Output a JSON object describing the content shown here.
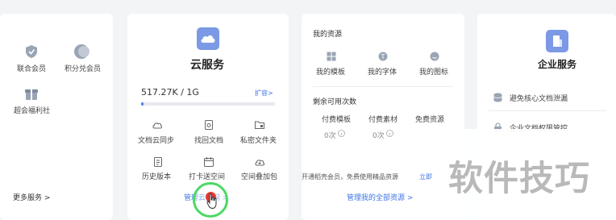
{
  "member_card": {
    "items": [
      {
        "label": "联合会员",
        "icon": "shield-icon"
      },
      {
        "label": "积分兑会员",
        "icon": "coin-icon"
      },
      {
        "label": "超会福利社",
        "icon": "gift-icon"
      }
    ],
    "more_label": "更多服务 >"
  },
  "cloud_card": {
    "title": "云服务",
    "usage": "517.27K / 1G",
    "expand_label": "扩容>",
    "usage_fraction": 0.02,
    "features": [
      {
        "label": "文档云同步",
        "icon": "cloud-sync-icon"
      },
      {
        "label": "找回文档",
        "icon": "recover-doc-icon"
      },
      {
        "label": "私密文件夹",
        "icon": "private-folder-icon"
      },
      {
        "label": "历史版本",
        "icon": "history-icon"
      },
      {
        "label": "打卡送空间",
        "icon": "checkin-calendar-icon"
      },
      {
        "label": "空间叠加包",
        "icon": "space-pack-icon"
      }
    ],
    "manage_label": "管理云空间 >"
  },
  "resource_card": {
    "title": "我的资源",
    "items": [
      {
        "label": "我的模板",
        "icon": "template-icon"
      },
      {
        "label": "我的字体",
        "icon": "font-icon"
      },
      {
        "label": "我的图标",
        "icon": "emoji-icon"
      }
    ],
    "remaining_title": "剩余可用次数",
    "quotas": [
      {
        "label": "付费模板",
        "value": "0次"
      },
      {
        "label": "付费素材",
        "value": "0次"
      },
      {
        "label": "免费资源",
        "value": ""
      }
    ],
    "promo_text": "开通稻壳会员，免费使用精品资源",
    "promo_link": "立即",
    "manage_all_label": "管理我的全部资源 >"
  },
  "enterprise_card": {
    "title": "企业服务",
    "items": [
      {
        "label": "避免核心文档泄漏",
        "icon": "database-icon"
      },
      {
        "label": "企业文档权限管控",
        "icon": "lock-icon"
      }
    ]
  },
  "watermark": {
    "text": "软件技巧"
  },
  "colors": {
    "accent": "#3d74e8",
    "badge": "#7b99e4",
    "progress": "#4a7fe8",
    "cursor_ring": "#4cd964",
    "click_dot": "#e53935"
  }
}
